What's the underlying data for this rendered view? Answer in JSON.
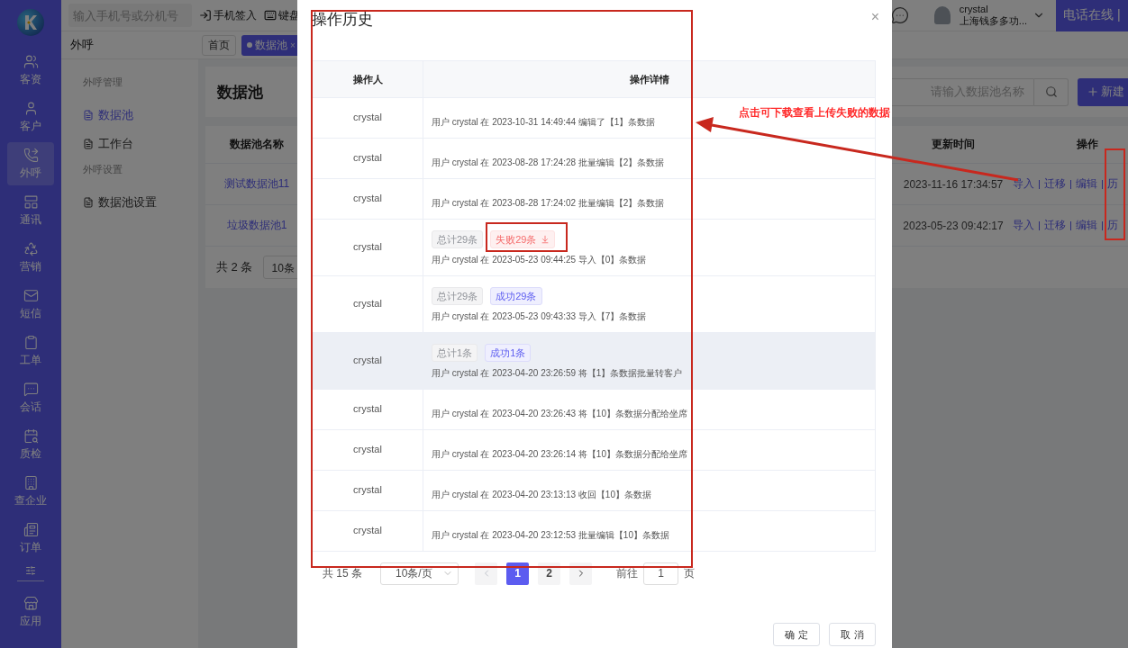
{
  "sidebar": {
    "items": [
      {
        "label": "客资",
        "selected": false
      },
      {
        "label": "客户",
        "selected": false
      },
      {
        "label": "外呼",
        "selected": true
      },
      {
        "label": "通讯",
        "selected": false
      },
      {
        "label": "营销",
        "selected": false
      },
      {
        "label": "短信",
        "selected": false
      },
      {
        "label": "工单",
        "selected": false
      },
      {
        "label": "会话",
        "selected": false
      },
      {
        "label": "质检",
        "selected": false
      },
      {
        "label": "查企业",
        "selected": false
      },
      {
        "label": "订单",
        "selected": false
      },
      {
        "label": "应用",
        "selected": false
      }
    ]
  },
  "topbar": {
    "search_placeholder": "输入手机号或分机号",
    "actions": [
      "手机签入",
      "键盘"
    ],
    "user": {
      "name": "crystal",
      "company": "上海钱多多功..."
    },
    "status_button": "电话在线 |"
  },
  "breadcrumb": "外呼",
  "page_tabs": [
    {
      "label": "首页",
      "selected": false
    },
    {
      "label": "数据池",
      "selected": true,
      "close": "×"
    }
  ],
  "menu": {
    "groups": [
      {
        "title": "外呼管理",
        "items": [
          {
            "label": "数据池",
            "selected": true
          },
          {
            "label": "工作台",
            "selected": false
          }
        ]
      },
      {
        "title": "外呼设置",
        "items": [
          {
            "label": "数据池设置",
            "selected": false
          }
        ]
      }
    ]
  },
  "content": {
    "title": "数据池",
    "search_placeholder": "请输入数据池名称",
    "new_button": "新建",
    "table": {
      "columns": [
        "数据池名称",
        "更新时间",
        "操作"
      ],
      "rows": [
        {
          "name": "测试数据池11",
          "updated": "2023-11-16 17:34:57",
          "actions": [
            "导入",
            "迁移",
            "编辑",
            "历"
          ]
        },
        {
          "name": "垃圾数据池1",
          "updated": "2023-05-23 09:42:17",
          "actions": [
            "导入",
            "迁移",
            "编辑",
            "历"
          ]
        }
      ]
    },
    "footer": {
      "total": "共 2 条",
      "page_size": "10条"
    }
  },
  "modal": {
    "title": "操作历史",
    "close": "×",
    "columns": [
      "操作人",
      "操作详情"
    ],
    "rows": [
      {
        "operator": "crystal",
        "highlighted": false,
        "detail": "用户 crystal 在 2023-10-31 14:49:44 编辑了【1】条数据"
      },
      {
        "operator": "crystal",
        "highlighted": false,
        "detail": "用户 crystal 在 2023-08-28 17:24:28 批量编辑【2】条数据"
      },
      {
        "operator": "crystal",
        "highlighted": false,
        "detail": "用户 crystal 在 2023-08-28 17:24:02 批量编辑【2】条数据"
      },
      {
        "operator": "crystal",
        "highlighted": false,
        "tags": [
          {
            "kind": "total",
            "label": "总计29条"
          },
          {
            "kind": "failed",
            "label": "失败29条",
            "download": true
          }
        ],
        "detail": "用户 crystal 在 2023-05-23 09:44:25 导入【0】条数据"
      },
      {
        "operator": "crystal",
        "highlighted": false,
        "tags": [
          {
            "kind": "total",
            "label": "总计29条"
          },
          {
            "kind": "success",
            "label": "成功29条",
            "download": false
          }
        ],
        "detail": "用户 crystal 在 2023-05-23 09:43:33 导入【7】条数据"
      },
      {
        "operator": "crystal",
        "highlighted": true,
        "tags": [
          {
            "kind": "total",
            "label": "总计1条"
          },
          {
            "kind": "success",
            "label": "成功1条",
            "download": false
          }
        ],
        "detail": "用户 crystal 在 2023-04-20 23:26:59 将【1】条数据批量转客户"
      },
      {
        "operator": "crystal",
        "highlighted": false,
        "detail": "用户 crystal 在 2023-04-20 23:26:43 将【10】条数据分配给坐席"
      },
      {
        "operator": "crystal",
        "highlighted": false,
        "detail": "用户 crystal 在 2023-04-20 23:26:14 将【10】条数据分配给坐席"
      },
      {
        "operator": "crystal",
        "highlighted": false,
        "detail": "用户 crystal 在 2023-04-20 23:13:13 收回【10】条数据"
      },
      {
        "operator": "crystal",
        "highlighted": false,
        "detail": "用户 crystal 在 2023-04-20 23:12:53 批量编辑【10】条数据"
      }
    ],
    "pagination": {
      "total": "共 15 条",
      "page_size": "10条/页",
      "prev_disabled": true,
      "next_disabled": false,
      "pages": [
        {
          "label": "1",
          "selected": true
        },
        {
          "label": "2",
          "selected": false
        }
      ],
      "goto_label": "前往",
      "goto_value": "1",
      "goto_suffix": "页"
    },
    "buttons": [
      "确 定",
      "取 消"
    ]
  },
  "annotation": {
    "note": "点击可下载查看上传失败的数据"
  }
}
